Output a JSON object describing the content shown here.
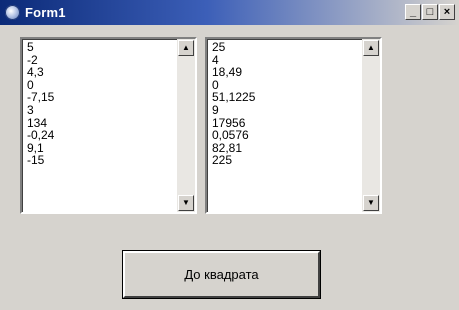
{
  "window": {
    "title": "Form1",
    "minimize_glyph": "_",
    "maximize_glyph": "□",
    "close_glyph": "×"
  },
  "left_list": {
    "items": [
      "5",
      "-2",
      "4,3",
      "0",
      "-7,15",
      "3",
      "134",
      "-0,24",
      "9,1",
      "-15"
    ]
  },
  "right_list": {
    "items": [
      "25",
      "4",
      "18,49",
      "0",
      "51,1225",
      "9",
      "17956",
      "0,0576",
      "82,81",
      "225"
    ]
  },
  "scroll": {
    "up_glyph": "▲",
    "down_glyph": "▼"
  },
  "button": {
    "label": "До квадрата"
  },
  "colors": {
    "face": "#d6d3ce",
    "title_start": "#0b2a78",
    "list_bg": "#ffffff"
  }
}
